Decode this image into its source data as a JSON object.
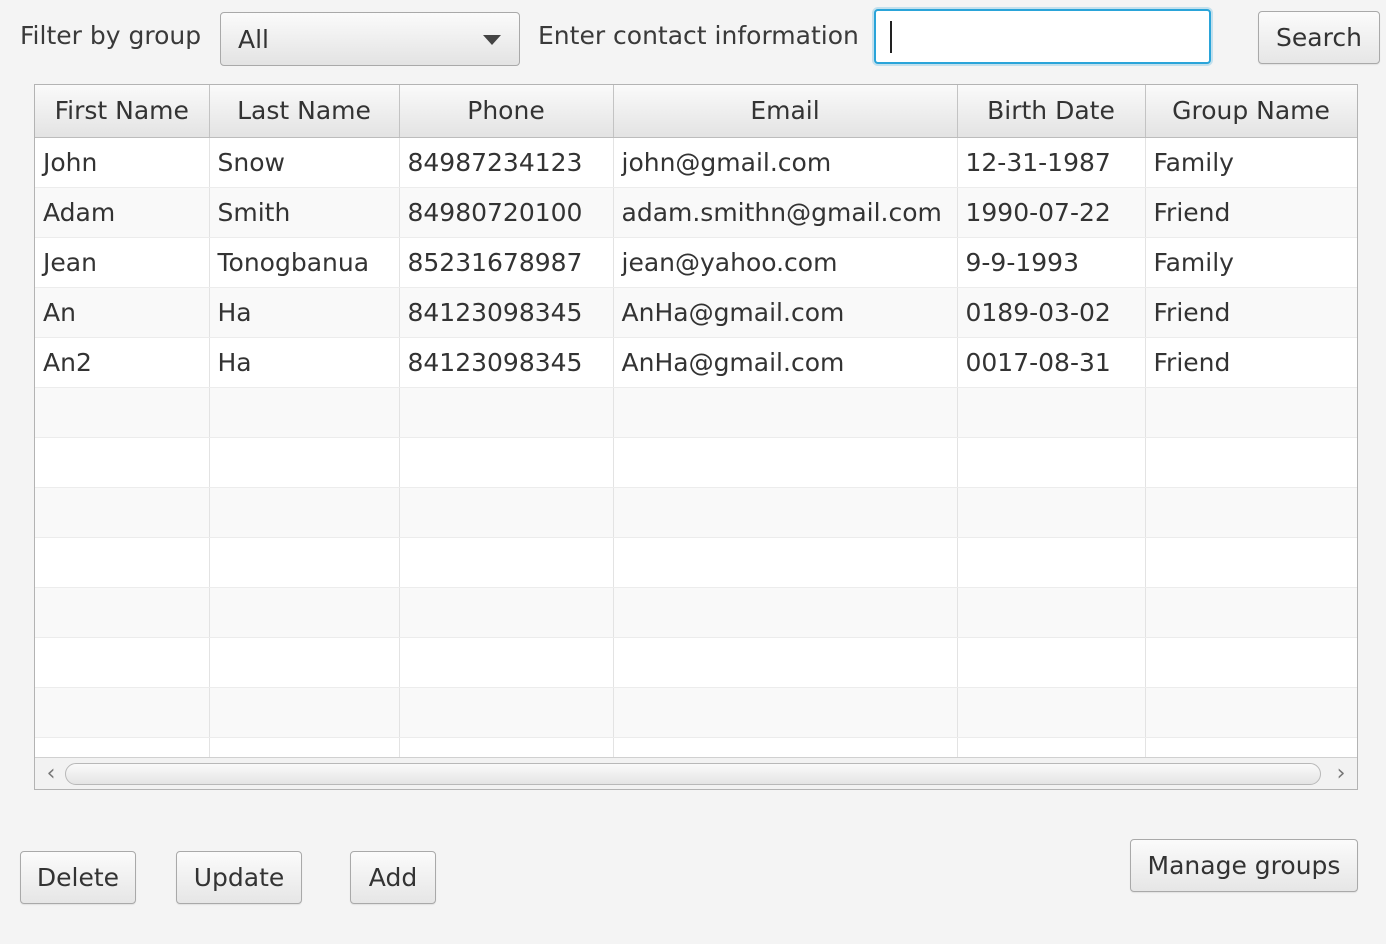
{
  "filter": {
    "label": "Filter by group",
    "selected": "All"
  },
  "search": {
    "label": "Enter contact information",
    "value": "",
    "placeholder": "",
    "button": "Search"
  },
  "table": {
    "columns": [
      "First Name",
      "Last Name",
      "Phone",
      "Email",
      "Birth Date",
      "Group Name"
    ],
    "rows": [
      [
        "John",
        "Snow",
        "84987234123",
        "john@gmail.com",
        "12-31-1987",
        "Family"
      ],
      [
        "Adam",
        "Smith",
        "84980720100",
        "adam.smithn@gmail.com",
        "1990-07-22",
        "Friend"
      ],
      [
        "Jean",
        "Tonogbanua",
        "85231678987",
        "jean@yahoo.com",
        "9-9-1993",
        "Family"
      ],
      [
        "An",
        "Ha",
        "84123098345",
        "AnHa@gmail.com",
        "0189-03-02",
        "Friend"
      ],
      [
        "An2",
        "Ha",
        "84123098345",
        "AnHa@gmail.com",
        "0017-08-31",
        "Friend"
      ]
    ],
    "empty_rows": 8
  },
  "actions": {
    "delete": "Delete",
    "update": "Update",
    "add": "Add",
    "manage_groups": "Manage groups"
  },
  "icons": {
    "dropdown": "chevron-down-icon",
    "scroll_left": "chevron-left-icon",
    "scroll_right": "chevron-right-icon"
  },
  "colors": {
    "focus_border": "#2aa4d9",
    "background": "#f4f4f4"
  }
}
